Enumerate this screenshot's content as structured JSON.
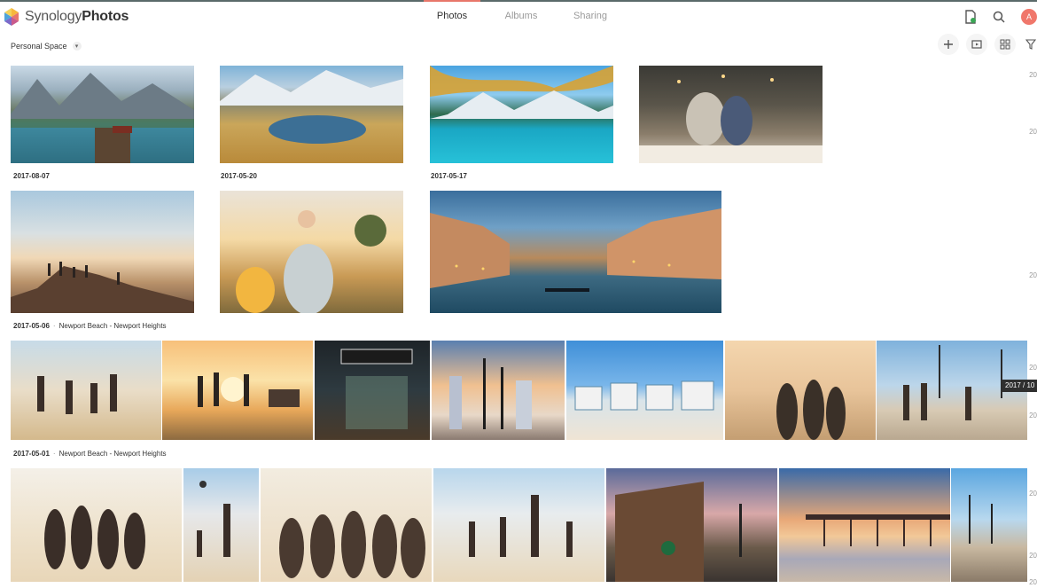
{
  "app": {
    "brand_light": "Synology",
    "brand_bold": "Photos"
  },
  "tabs": [
    {
      "label": "Photos",
      "active": true
    },
    {
      "label": "Albums",
      "active": false
    },
    {
      "label": "Sharing",
      "active": false
    }
  ],
  "top_icons": [
    "document-status-icon",
    "search-icon"
  ],
  "avatar": {
    "initial": "A",
    "color": "#f0776b"
  },
  "space_selector": {
    "label": "Personal Space"
  },
  "toolbar": [
    "add-icon",
    "slideshow-icon",
    "grid-view-icon",
    "filter-icon"
  ],
  "timeline_ticks": [
    "20",
    "20",
    "20",
    "20",
    "20",
    "20",
    "20",
    "20"
  ],
  "timeline_tooltip": "2017 / 10",
  "groups": [
    {
      "date": "2017-08-07",
      "location": ""
    },
    {
      "date": "2017-05-20",
      "location": ""
    },
    {
      "date": "2017-05-17",
      "location": ""
    },
    {
      "date": "2017-05-06",
      "location": "Newport Beach - Newport Heights"
    },
    {
      "date": "2017-05-01",
      "location": "Newport Beach - Newport Heights"
    }
  ],
  "photos": [
    {
      "name": "mountain-lake-boats-photo"
    },
    {
      "name": "alpine-tarn-photo"
    },
    {
      "name": "turquoise-lake-photo"
    },
    {
      "name": "family-dinner-photo"
    },
    {
      "name": "hikers-summit-photo"
    },
    {
      "name": "father-child-field-photo"
    },
    {
      "name": "venice-canal-photo"
    },
    {
      "name": "beach-skating-friends-photo"
    },
    {
      "name": "lifeguard-tower-jump-photo"
    },
    {
      "name": "starbucks-storefront-photo"
    },
    {
      "name": "palm-skyline-photo"
    },
    {
      "name": "beach-houses-photo"
    },
    {
      "name": "friends-selfie-sunset-photo"
    },
    {
      "name": "boardwalk-palms-photo"
    },
    {
      "name": "beach-group-photo"
    },
    {
      "name": "volleyball-photo"
    },
    {
      "name": "party-friends-photo"
    },
    {
      "name": "beach-volleyball-group-photo"
    },
    {
      "name": "starbucks-corner-photo"
    },
    {
      "name": "pier-sunset-photo"
    },
    {
      "name": "sand-palms-photo"
    }
  ]
}
